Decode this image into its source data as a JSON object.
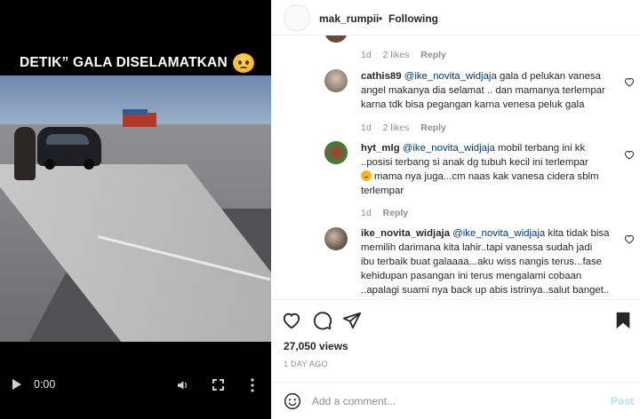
{
  "video": {
    "caption": "DETIK” GALA DISELAMATKAN",
    "time": "0:00"
  },
  "header": {
    "username": "mak_rumpii",
    "separator": "•",
    "follow_status": "Following"
  },
  "comments": [
    {
      "meta": {
        "age": "1d",
        "likes": "2 likes",
        "reply": "Reply"
      }
    },
    {
      "username": "cathis89",
      "mention": "@ike_novita_widjaja",
      "lines": [
        "gala d pelukan vanesa",
        "angel makanya dia selamat .. dan mamanya terlempar",
        "karna tdk bisa pegangan karna venesa peluk gala"
      ],
      "meta": {
        "age": "1d",
        "likes": "2 likes",
        "reply": "Reply"
      }
    },
    {
      "username": "hyt_mlg",
      "mention": "@ike_novita_widjaja",
      "lines": [
        "mobil terbang ini kk",
        "..posisi terbang si anak dg tubuh kecil ini terlempar",
        "mama nya juga...cm naas kak vanesa cidera sblm",
        "terlempar"
      ],
      "meta": {
        "age": "1d",
        "reply": "Reply"
      }
    },
    {
      "username": "ike_novita_widjaja",
      "mention": "@ike_novita_widjaja",
      "lines": [
        "kita tidak bisa",
        "memilih darimana kita lahir..tapi vanessa sudah jadi",
        "ibu terbaik buat galaaaa...aku wiss nangis terus...fase",
        "kehidupan pasangan ini terus mengalami cobaan",
        "..apalagi suami nya back up abis istrinya..salut banget.."
      ]
    }
  ],
  "stats": {
    "views": "27,050 views",
    "ago": "1 DAY AGO"
  },
  "add_comment": {
    "placeholder": "Add a comment...",
    "post_label": "Post"
  },
  "colors": {
    "mention": "#00376b",
    "post_disabled": "#b2dffc",
    "meta_gray": "#8e8e8e"
  }
}
